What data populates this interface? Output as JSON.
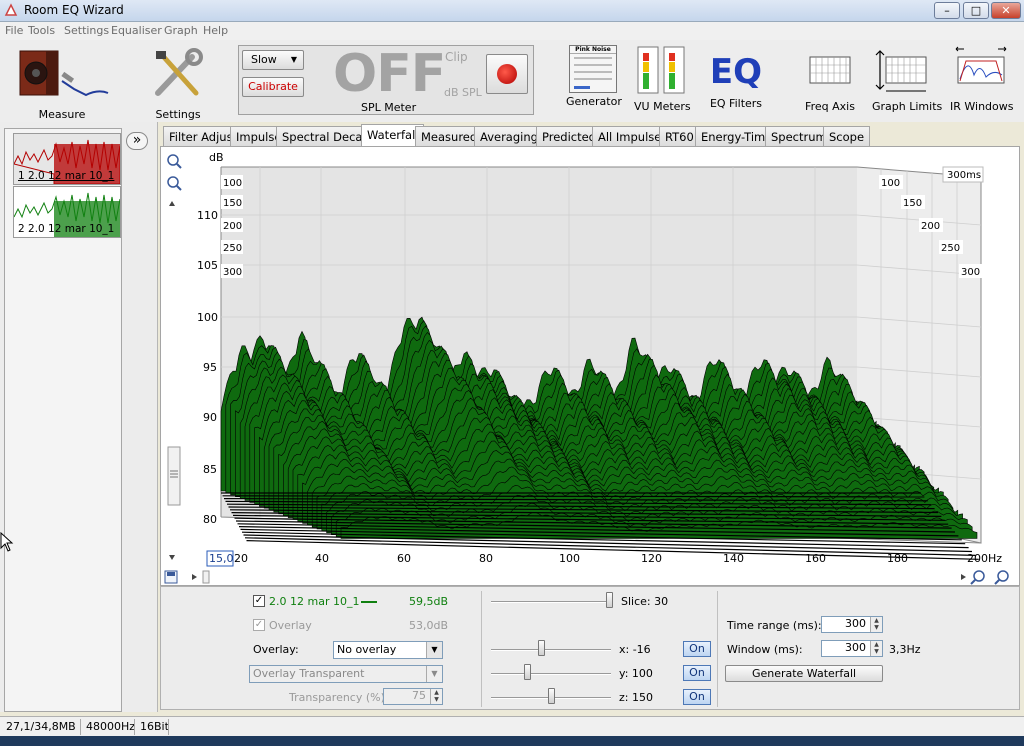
{
  "window": {
    "title": "Room EQ Wizard",
    "minimize": "–",
    "maximize": "□",
    "close": "✕"
  },
  "menu": [
    "File",
    "Tools",
    "Settings",
    "Equaliser",
    "Graph",
    "Help"
  ],
  "toolbar": {
    "measure": "Measure",
    "settings": "Settings",
    "spl": {
      "speed": "Slow",
      "calibrate": "Calibrate",
      "big": "OFF",
      "clip": "Clip",
      "unit": "dB SPL",
      "label": "SPL Meter"
    },
    "generator": "Generator",
    "generator_badge": "Pink Noise",
    "vu": "VU Meters",
    "eq_logo": "EQ",
    "eq": "EQ Filters",
    "freq_axis": "Freq Axis",
    "graph_limits": "Graph Limits",
    "ir_windows": "IR Windows"
  },
  "measurements": [
    {
      "label": "1 2.0 12 mar 10_1",
      "color": "#b40000"
    },
    {
      "label": "2 2.0 12 mar 10_1",
      "color": "#108010"
    }
  ],
  "expand_icon": "»",
  "tabs": [
    "Filter Adjust",
    "Impulse",
    "Spectral Decay",
    "Waterfall",
    "Measured",
    "Averaging",
    "Predicted",
    "All Impulses",
    "RT60",
    "Energy-Time",
    "Spectrum",
    "Scope"
  ],
  "active_tab": "Waterfall",
  "graph": {
    "ylabel": "dB",
    "yticks": [
      "110",
      "105",
      "100",
      "95",
      "90",
      "85",
      "80"
    ],
    "xticks": [
      "20",
      "40",
      "60",
      "80",
      "100",
      "120",
      "140",
      "160",
      "180",
      "200Hz"
    ],
    "xstart": "15,0",
    "time_labels_left": [
      "100",
      "150",
      "200",
      "250",
      "300"
    ],
    "time_labels_right": [
      "100",
      "150",
      "200",
      "250",
      "300"
    ],
    "time_unit": "300ms",
    "fill": "#0f6a0f"
  },
  "controls": {
    "meas_name": "2.0 12 mar 10_1",
    "meas_level": "59,5dB",
    "overlay_label": "Overlay",
    "overlay_level": "53,0dB",
    "overlay_select_label": "Overlay:",
    "overlay_select": "No overlay",
    "overlay_mode": "Overlay Transparent",
    "transparency_label": "Transparency (%)",
    "transparency": "75",
    "slice": "Slice: 30",
    "x": "x: -16",
    "y": "y: 100",
    "z": "z: 150",
    "on": "On",
    "time_range_label": "Time range (ms):",
    "time_range": "300",
    "window_label": "Window (ms):",
    "window": "300",
    "window_res": "3,3Hz",
    "generate": "Generate Waterfall"
  },
  "status": {
    "memory": "27,1/34,8MB",
    "rate": "48000Hz",
    "bits": "16Bit"
  }
}
